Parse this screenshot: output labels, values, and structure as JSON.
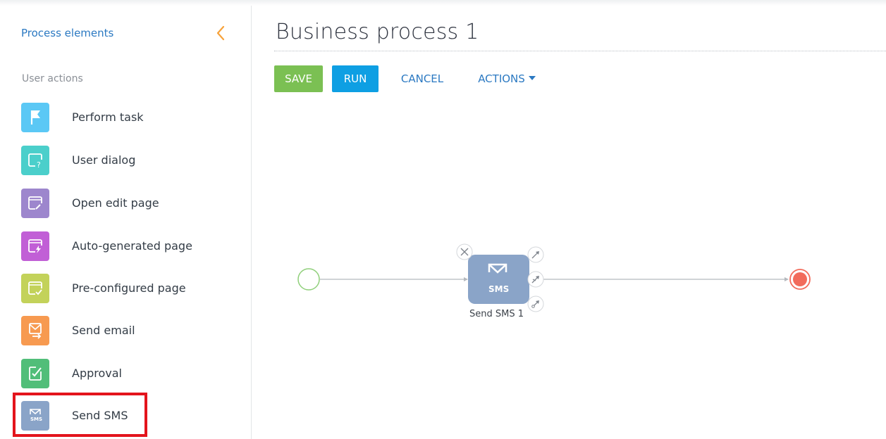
{
  "sidebar": {
    "header": "Process elements",
    "section_label": "User actions",
    "items": [
      {
        "label": "Perform task",
        "icon": "flag-icon",
        "color": "#5bc8f5"
      },
      {
        "label": "User dialog",
        "icon": "dialog-question-icon",
        "color": "#4bcfcb"
      },
      {
        "label": "Open edit page",
        "icon": "edit-page-icon",
        "color": "#9d86cd"
      },
      {
        "label": "Auto-generated page",
        "icon": "auto-page-icon",
        "color": "#c15fd6"
      },
      {
        "label": "Pre-configured page",
        "icon": "preconfigured-page-icon",
        "color": "#c3d25a"
      },
      {
        "label": "Send email",
        "icon": "email-icon",
        "color": "#f79a50"
      },
      {
        "label": "Approval",
        "icon": "approval-icon",
        "color": "#51be79"
      },
      {
        "label": "Send SMS",
        "icon": "sms-icon",
        "color": "#8aa4c8"
      }
    ]
  },
  "header": {
    "title": "Business process 1"
  },
  "toolbar": {
    "save_label": "SAVE",
    "run_label": "RUN",
    "cancel_label": "CANCEL",
    "actions_label": "ACTIONS"
  },
  "canvas": {
    "node_label": "Send SMS 1",
    "node_icon_text": "SMS",
    "colors": {
      "start": "#8fcf7a",
      "end": "#f26b5b",
      "node": "#8aa4c8",
      "connector": "#b5b9be"
    }
  }
}
